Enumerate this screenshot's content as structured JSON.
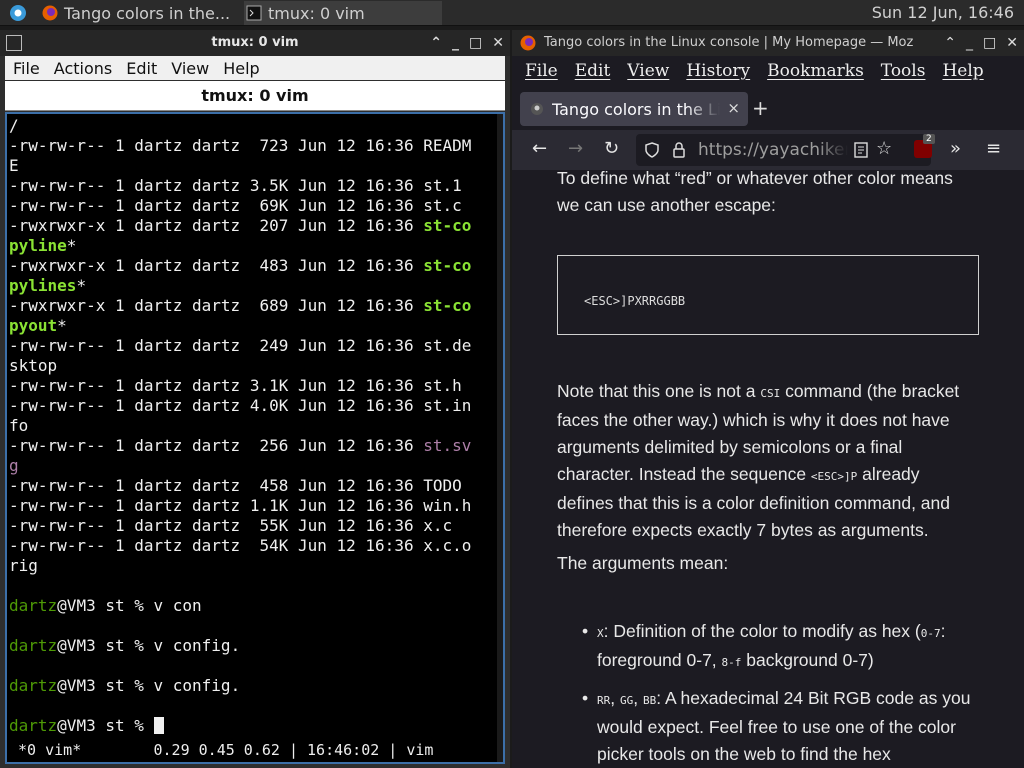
{
  "panel": {
    "task1": "Tango colors in the...",
    "task2": "tmux: 0 vim",
    "clock": "Sun 12 Jun, 16:46"
  },
  "terminal": {
    "window_title": "tmux: 0 vim",
    "menu": [
      "File",
      "Actions",
      "Edit",
      "View",
      "Help"
    ],
    "tab_title": "tmux: 0 vim",
    "lines": [
      {
        "t": "/"
      },
      {
        "t": "-rw-rw-r-- 1 dartz dartz  723 Jun 12 16:36 READM"
      },
      {
        "t": "E"
      },
      {
        "t": "-rw-rw-r-- 1 dartz dartz 3.5K Jun 12 16:36 st.1"
      },
      {
        "t": "-rw-rw-r-- 1 dartz dartz  69K Jun 12 16:36 st.c"
      },
      {
        "t": "-rwxrwxr-x 1 dartz dartz  207 Jun 12 16:36 ",
        "g": "st-co"
      },
      {
        "g": "pyline",
        "s": "*"
      },
      {
        "t": "-rwxrwxr-x 1 dartz dartz  483 Jun 12 16:36 ",
        "g": "st-co"
      },
      {
        "g": "pylines",
        "s": "*"
      },
      {
        "t": "-rwxrwxr-x 1 dartz dartz  689 Jun 12 16:36 ",
        "g": "st-co"
      },
      {
        "g": "pyout",
        "s": "*"
      },
      {
        "t": "-rw-rw-r-- 1 dartz dartz  249 Jun 12 16:36 st.de"
      },
      {
        "t": "sktop"
      },
      {
        "t": "-rw-rw-r-- 1 dartz dartz 3.1K Jun 12 16:36 st.h"
      },
      {
        "t": "-rw-rw-r-- 1 dartz dartz 4.0K Jun 12 16:36 st.in"
      },
      {
        "t": "fo"
      },
      {
        "t": "-rw-rw-r-- 1 dartz dartz  256 Jun 12 16:36 ",
        "m": "st.sv"
      },
      {
        "m": "g"
      },
      {
        "t": "-rw-rw-r-- 1 dartz dartz  458 Jun 12 16:36 TODO"
      },
      {
        "t": "-rw-rw-r-- 1 dartz dartz 1.1K Jun 12 16:36 win.h"
      },
      {
        "t": "-rw-rw-r-- 1 dartz dartz  55K Jun 12 16:36 x.c"
      },
      {
        "t": "-rw-rw-r-- 1 dartz dartz  54K Jun 12 16:36 x.c.o"
      },
      {
        "t": "rig"
      },
      {
        "t": ""
      },
      {
        "p": "dartz",
        "t": "@VM3 st % v con"
      },
      {
        "t": ""
      },
      {
        "p": "dartz",
        "t": "@VM3 st % v config."
      },
      {
        "t": ""
      },
      {
        "p": "dartz",
        "t": "@VM3 st % v config."
      },
      {
        "t": ""
      },
      {
        "p": "dartz",
        "t": "@VM3 st % ",
        "cursor": true
      }
    ],
    "status": " *0 vim*        0.29 0.45 0.62 | 16:46:02 | vim"
  },
  "browser": {
    "window_title": "Tango colors in the Linux console | My Homepage — Moz",
    "menu": [
      "File",
      "Edit",
      "View",
      "History",
      "Bookmarks",
      "Tools",
      "Help"
    ],
    "tab_label": "Tango colors in the Linux console",
    "tab_close": "×",
    "new_tab": "+",
    "url": "https://yayachiken.net",
    "badge": "2",
    "content": {
      "p1": "To define what “red” or whatever other color means we can use another escape:",
      "code": "<ESC>]PXRRGGBB",
      "p2a": "Note that this one is not a ",
      "p2_csi": "CSI",
      "p2b": " command (the bracket faces the other way.) which is why it does not have arguments delimited by semicolons or a final character. Instead the sequence ",
      "p2_esc": "<ESC>]P",
      "p2c": " already defines that this is a color definition command, and therefore expects exactly 7 bytes as arguments.",
      "p3": "The arguments mean:",
      "b1_code": "X",
      "b1a": ": Definition of the color to modify as hex (",
      "b1_range1": "0-7",
      "b1b": ": foreground 0-7, ",
      "b1_range2": "8-f",
      "b1c": " background 0-7)",
      "b2_c1": "RR",
      "b2_c2": "GG",
      "b2_c3": "BB",
      "b2a": ": A hexadecimal 24 Bit RGB code as you would expect. Feel free to use one of the color picker tools on the web to find the hex"
    }
  }
}
